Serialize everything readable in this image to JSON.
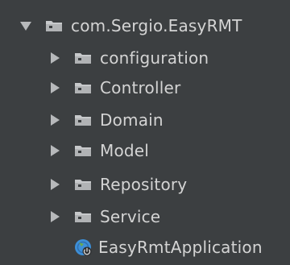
{
  "tree": {
    "root": {
      "label": "com.Sergio.EasyRMT",
      "expanded": true,
      "icon": "package-folder-icon"
    },
    "children": [
      {
        "label": "configuration",
        "expanded": false,
        "icon": "package-folder-icon"
      },
      {
        "label": "Controller",
        "expanded": false,
        "icon": "package-folder-icon"
      },
      {
        "label": "Domain",
        "expanded": false,
        "icon": "package-folder-icon"
      },
      {
        "label": "Model",
        "expanded": false,
        "icon": "package-folder-icon"
      },
      {
        "label": "Repository",
        "expanded": false,
        "icon": "package-folder-icon"
      },
      {
        "label": "Service",
        "expanded": false,
        "icon": "package-folder-icon"
      }
    ],
    "file": {
      "label": "EasyRmtApplication",
      "icon": "spring-boot-application-icon"
    }
  },
  "colors": {
    "background": "#3c3f41",
    "text": "#d4d4d4",
    "arrow": "#b7b9bb",
    "folder": "#c7c9cb",
    "app_icon": "#3d8fd8",
    "app_icon_badge": "#6aaa4e"
  }
}
